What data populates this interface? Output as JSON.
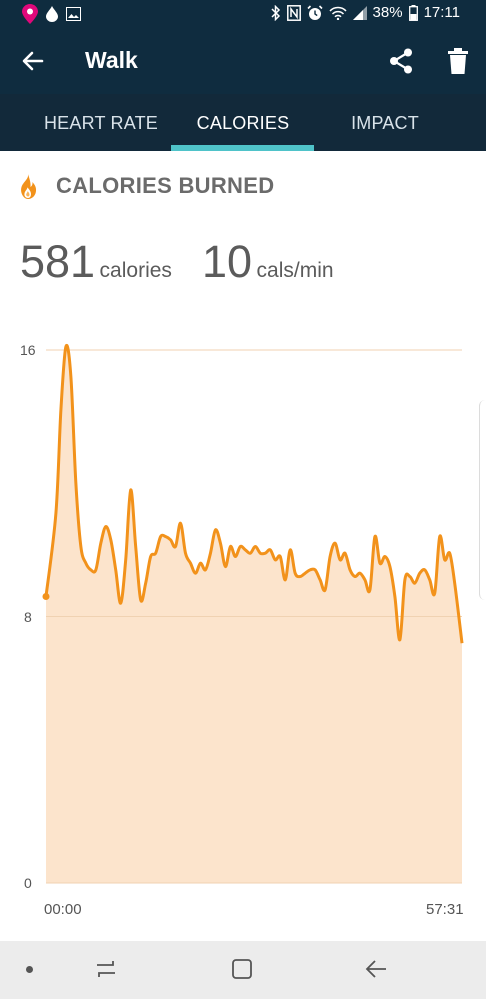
{
  "status_bar": {
    "battery": "38%",
    "time": "17:11",
    "icons": [
      "tmobile-pin-icon",
      "droplet-icon",
      "image-icon",
      "bluetooth-icon",
      "nfc-icon",
      "alarm-icon",
      "wifi-icon",
      "signal-icon",
      "battery-icon"
    ]
  },
  "app_bar": {
    "title": "Walk",
    "icons": [
      "back-arrow-icon",
      "share-icon",
      "trash-icon"
    ]
  },
  "tabs": [
    {
      "label": "HEART RATE",
      "active": false
    },
    {
      "label": "CALORIES",
      "active": true
    },
    {
      "label": "IMPACT",
      "active": false
    }
  ],
  "section": {
    "title": "CALORIES BURNED",
    "icon": "flame-icon"
  },
  "stats": {
    "calories_value": "581",
    "calories_unit": "calories",
    "rate_value": "10",
    "rate_unit": "cals/min"
  },
  "chart_data": {
    "type": "area",
    "y_ticks": [
      "16",
      "8",
      "0"
    ],
    "x_ticks": [
      "00:00",
      "57:31"
    ],
    "ylim": [
      0,
      16
    ],
    "xlim": [
      0,
      57.52
    ],
    "x": [
      0,
      1.37,
      2.06,
      2.75,
      3.44,
      4.13,
      4.82,
      5.51,
      6.2,
      6.89,
      7.58,
      8.27,
      8.96,
      9.64,
      10.33,
      11.02,
      11.71,
      12.4,
      13.09,
      13.78,
      14.47,
      15.16,
      15.85,
      16.54,
      17.23,
      17.91,
      18.6,
      19.29,
      19.98,
      20.67,
      21.36,
      22.05,
      22.74,
      23.43,
      24.12,
      24.81,
      25.5,
      26.18,
      26.87,
      27.56,
      28.25,
      28.94,
      29.63,
      30.32,
      31.01,
      31.7,
      32.39,
      33.08,
      33.77,
      34.45,
      35.14,
      35.83,
      36.52,
      37.21,
      37.9,
      38.59,
      39.28,
      39.97,
      40.66,
      41.35,
      42.04,
      42.72,
      43.41,
      44.1,
      44.79,
      45.48,
      46.17,
      46.86,
      47.55,
      48.24,
      48.93,
      49.62,
      50.31,
      50.99,
      51.68,
      52.37,
      53.06,
      53.75,
      54.44,
      55.13,
      55.82,
      56.51,
      57.52
    ],
    "y": [
      8.6,
      11.1,
      14.2,
      16.1,
      15.2,
      12.0,
      10.1,
      9.6,
      9.4,
      9.4,
      10.2,
      10.7,
      10.3,
      9.4,
      8.4,
      9.7,
      11.8,
      10.1,
      8.5,
      9.0,
      9.8,
      9.9,
      10.4,
      10.4,
      10.3,
      10.1,
      10.8,
      9.9,
      9.6,
      9.3,
      9.6,
      9.4,
      9.9,
      10.6,
      10.2,
      9.5,
      10.1,
      9.8,
      10.1,
      10.0,
      9.9,
      10.1,
      9.9,
      9.9,
      10.0,
      9.7,
      9.8,
      9.1,
      10.0,
      9.3,
      9.2,
      9.3,
      9.4,
      9.4,
      9.1,
      8.8,
      9.8,
      10.2,
      9.7,
      9.9,
      9.4,
      9.2,
      9.3,
      9.1,
      8.8,
      10.4,
      9.6,
      9.8,
      9.5,
      8.6,
      7.3,
      9.1,
      9.2,
      9.0,
      9.3,
      9.4,
      9.1,
      8.7,
      10.4,
      9.7,
      9.9,
      9.0,
      7.2
    ],
    "grid": true,
    "series": [
      {
        "color": "#f2921b"
      }
    ],
    "fill_color": "#fce4cc"
  },
  "nav_bar": {
    "icons": [
      "dot-icon",
      "recents-icon",
      "home-icon",
      "back-icon"
    ]
  },
  "colors": {
    "header_bg": "#0f2c3f",
    "tab_bg": "#12293a",
    "tab_indicator": "#4fc3c9",
    "accent_orange": "#f2921b"
  }
}
